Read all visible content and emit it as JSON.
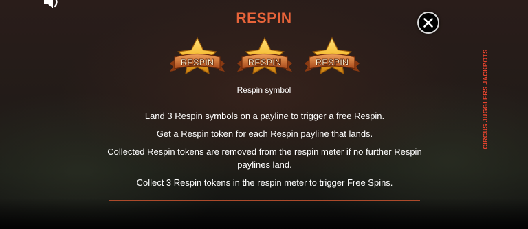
{
  "theme": {
    "title_color": "#e8643a",
    "text_color": "#ffffff",
    "side_label_color": "#e8442e",
    "divider_color": "#b8502e"
  },
  "header": {
    "title": "RESPIN",
    "sound_icon": "speaker-icon",
    "close_icon": "close-x-icon"
  },
  "side_label": "CIRCUS JUGGLERS JACKPOTS",
  "symbols": {
    "items": [
      {
        "label": "RESPIN"
      },
      {
        "label": "RESPIN"
      },
      {
        "label": "RESPIN"
      }
    ],
    "caption": "Respin symbol"
  },
  "description": [
    "Land 3 Respin symbols on a payline to trigger a free Respin.",
    "Get a Respin token for each Respin payline that lands.",
    "Collected Respin tokens are removed from the respin meter if no further Respin paylines land.",
    "Collect 3 Respin tokens in the respin meter to trigger Free Spins."
  ]
}
